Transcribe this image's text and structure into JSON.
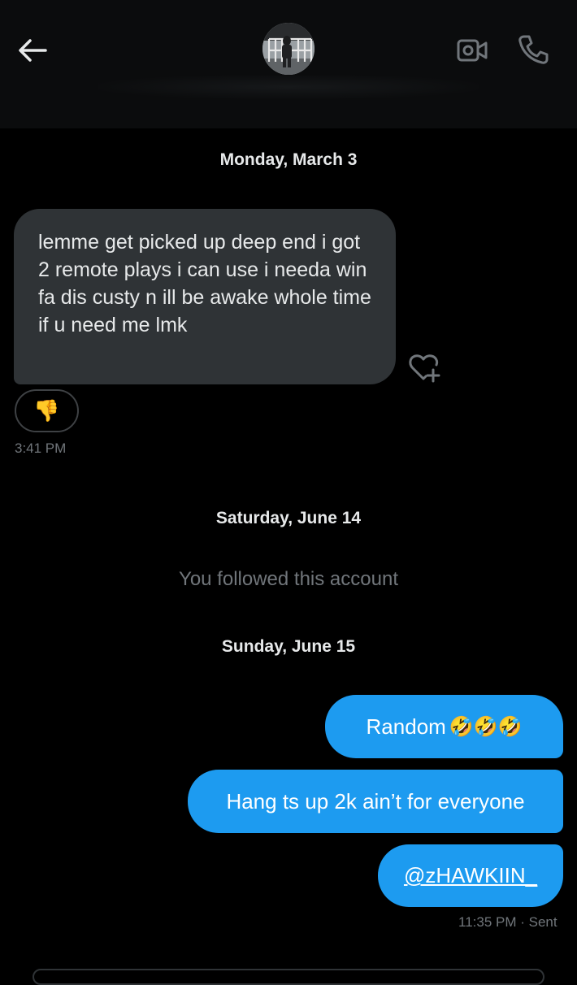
{
  "header": {
    "back_icon": "arrow-left-icon",
    "video_icon": "video-camera-icon",
    "call_icon": "phone-icon"
  },
  "conversation": {
    "date1": "Monday, March 3",
    "incoming_message": {
      "text": "lemme get picked up deep end i got 2 remote plays i can use i needa win fa dis custy n ill be awake whole time if u need me lmk",
      "reaction": "👎",
      "time": "3:41 PM",
      "react_icon": "heart-plus-icon"
    },
    "date2": "Saturday, June 14",
    "system_note": "You followed this account",
    "date3": "Sunday, June 15",
    "outgoing_messages": [
      {
        "text": "Random",
        "emojis": "🤣🤣🤣"
      },
      {
        "text": "Hang ts up 2k ain’t for everyone"
      },
      {
        "text": "@zHAWKIIN_"
      }
    ],
    "sent_time": "11:35 PM",
    "sent_status": "· Sent"
  },
  "colors": {
    "background": "#000000",
    "incoming_bubble": "#2f3336",
    "outgoing_bubble": "#1d9bf0",
    "muted_text": "#71767b"
  }
}
